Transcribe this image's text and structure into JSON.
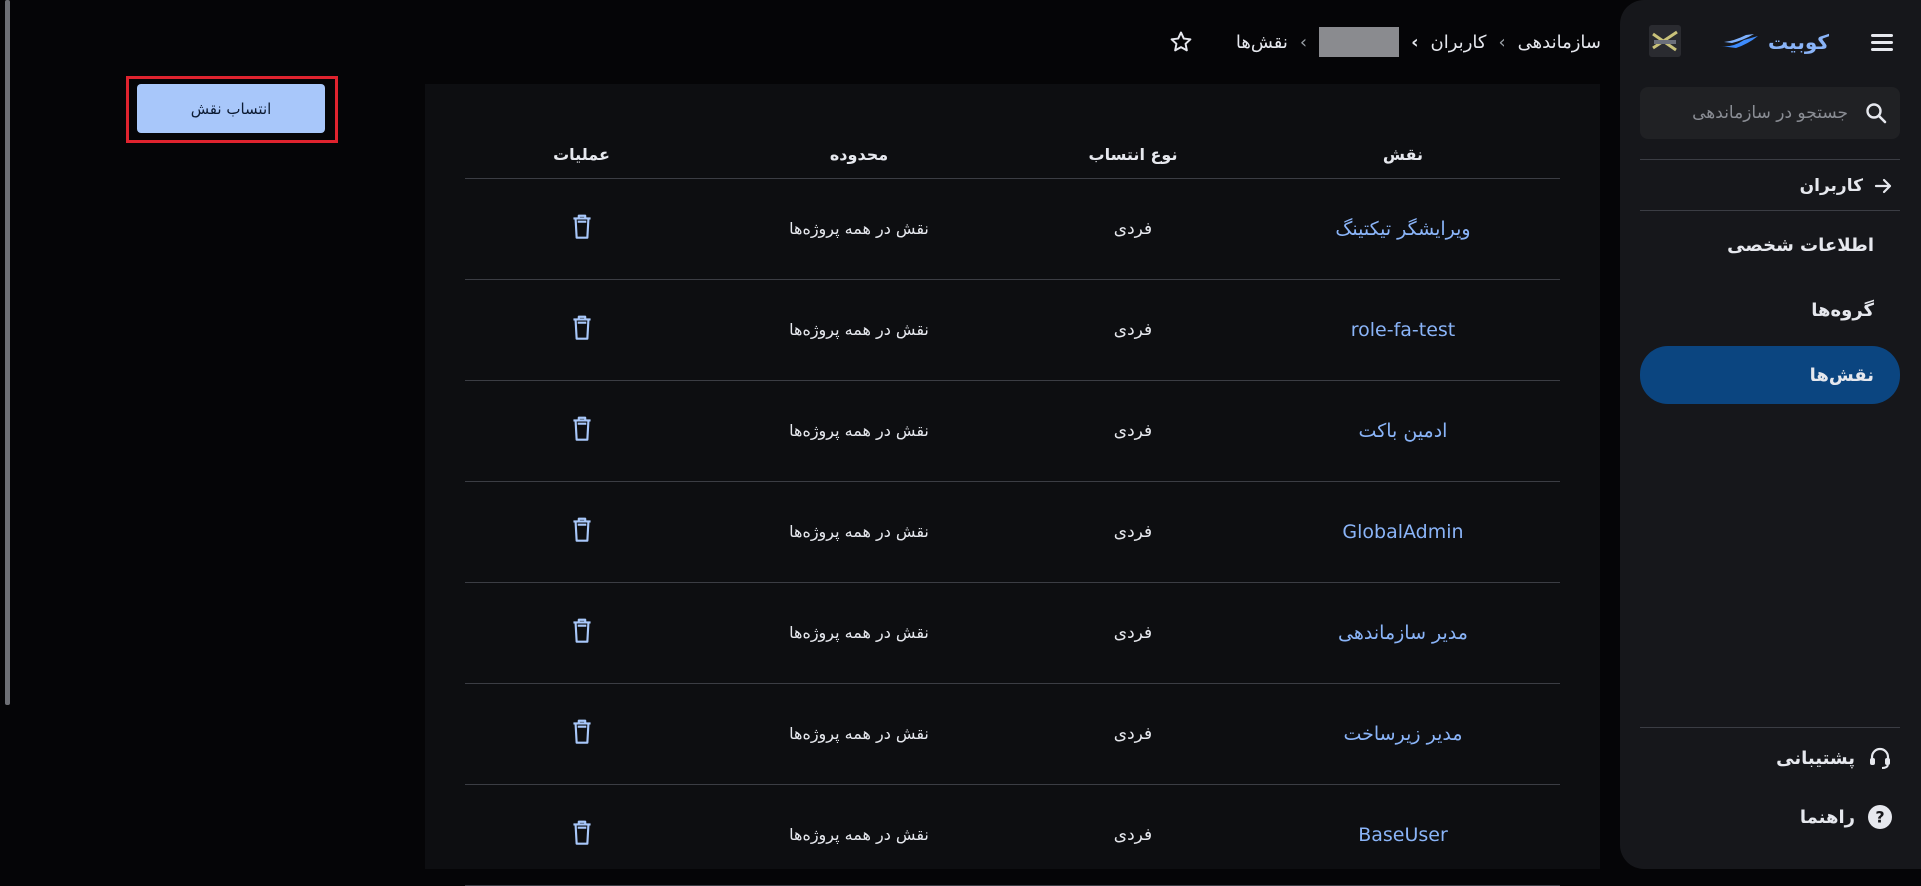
{
  "sidebar": {
    "brand_name": "کوبیت",
    "search_placeholder": "جستجو در سازماندهی",
    "back_label": "کاربران",
    "nav_items": [
      {
        "label": "اطلاعات شخصی",
        "active": false
      },
      {
        "label": "گروه‌ها",
        "active": false
      },
      {
        "label": "نقش‌ها",
        "active": true
      }
    ],
    "footer": {
      "support_label": "پشتیبانی",
      "help_label": "راهنما"
    }
  },
  "breadcrumb": {
    "items": [
      "سازماندهی",
      "کاربران",
      "",
      "نقش‌ها"
    ]
  },
  "actions": {
    "assign_role_label": "انتساب نقش"
  },
  "table": {
    "headers": {
      "role": "نقش",
      "assignment_type": "نوع انتساب",
      "scope": "محدوده",
      "operations": "عملیات"
    },
    "rows": [
      {
        "role": "ویرایشگر تیکتینگ",
        "type": "فردی",
        "scope": "نقش در همه پروژه‌ها"
      },
      {
        "role": "role-fa-test",
        "type": "فردی",
        "scope": "نقش در همه پروژه‌ها"
      },
      {
        "role": "ادمین باکت",
        "type": "فردی",
        "scope": "نقش در همه پروژه‌ها"
      },
      {
        "role": "GlobalAdmin",
        "type": "فردی",
        "scope": "نقش در همه پروژه‌ها"
      },
      {
        "role": "مدیر سازماندهی",
        "type": "فردی",
        "scope": "نقش در همه پروژه‌ها"
      },
      {
        "role": "مدیر زیرساخت",
        "type": "فردی",
        "scope": "نقش در همه پروژه‌ها"
      },
      {
        "role": "BaseUser",
        "type": "فردی",
        "scope": "نقش در همه پروژه‌ها"
      }
    ]
  },
  "icons": {
    "menu": "hamburger-icon",
    "search": "search-icon",
    "back": "arrow-right-icon",
    "star": "star-outline-icon",
    "delete": "trash-icon",
    "support": "headset-icon",
    "help": "help-circle-icon"
  },
  "colors": {
    "accent": "#8ab4f8",
    "primary_button": "#a8c7fa",
    "active_nav": "#0b4580",
    "highlight_border": "#e0232e"
  }
}
